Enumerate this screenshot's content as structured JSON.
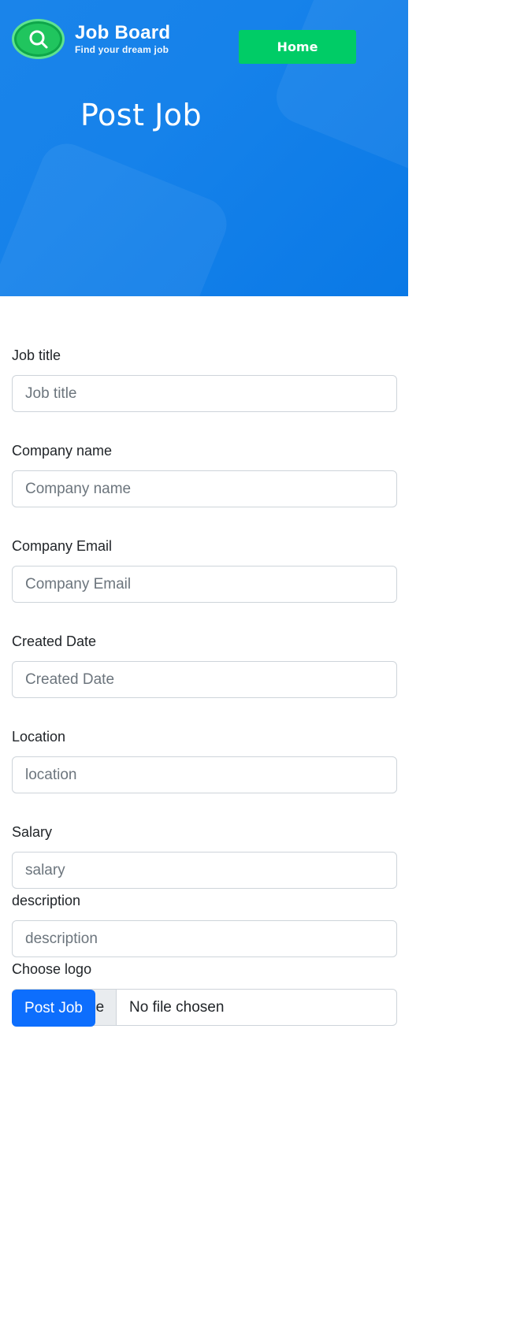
{
  "header": {
    "brand_title": "Job Board",
    "brand_subtitle": "Find your dream job",
    "logo_icon": "search-icon",
    "home_button": "Home",
    "page_title": "Post Job",
    "colors": {
      "hero": "#1682ea",
      "home_button": "#00cc66",
      "logo": "#20c55e"
    }
  },
  "form": {
    "job_title": {
      "label": "Job title",
      "placeholder": "Job title"
    },
    "company_name": {
      "label": "Company name",
      "placeholder": "Company name"
    },
    "company_email": {
      "label": "Company Email",
      "placeholder": "Company Email"
    },
    "created_date": {
      "label": "Created Date",
      "placeholder": "Created Date"
    },
    "location": {
      "label": "Location",
      "placeholder": "location"
    },
    "salary": {
      "label": "Salary",
      "placeholder": "salary"
    },
    "description": {
      "label": "description",
      "placeholder": "description"
    },
    "logo": {
      "label": "Choose logo",
      "button": "Choose File",
      "status": "No file chosen"
    },
    "submit": "Post Job",
    "colors": {
      "submit": "#0d6efd"
    }
  }
}
